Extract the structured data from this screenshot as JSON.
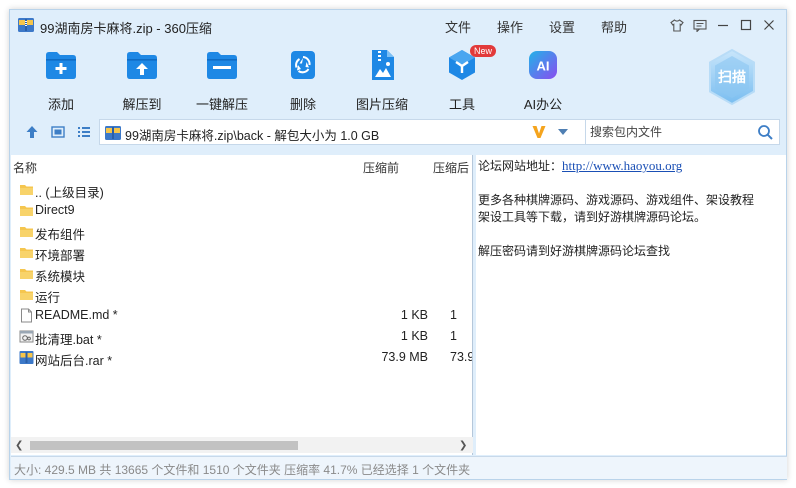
{
  "window": {
    "title": "99湖南房卡麻将.zip - 360压缩"
  },
  "menu": {
    "items": [
      "文件",
      "操作",
      "设置",
      "帮助"
    ]
  },
  "toolbar": {
    "items": [
      {
        "label": "添加",
        "icon": "add-folder-icon"
      },
      {
        "label": "解压到",
        "icon": "extract-to-icon"
      },
      {
        "label": "一键解压",
        "icon": "one-click-extract-icon"
      },
      {
        "label": "删除",
        "icon": "recycle-bin-icon"
      },
      {
        "label": "图片压缩",
        "icon": "image-compress-icon"
      },
      {
        "label": "工具",
        "icon": "tools-icon",
        "badge": "New"
      },
      {
        "label": "AI办公",
        "icon": "ai-office-icon",
        "icon_text": "AI"
      }
    ],
    "scan_label": "扫描"
  },
  "address": {
    "path": "99湖南房卡麻将.zip\\back - 解包大小为 1.0 GB"
  },
  "search": {
    "placeholder": "搜索包内文件"
  },
  "file_list": {
    "columns": [
      "名称",
      "压缩前",
      "压缩后"
    ],
    "rows": [
      {
        "name": ".. (上级目录)",
        "type": "folder",
        "size": "",
        "packed": ""
      },
      {
        "name": "Direct9",
        "type": "folder",
        "size": "",
        "packed": ""
      },
      {
        "name": "发布组件",
        "type": "folder",
        "size": "",
        "packed": ""
      },
      {
        "name": "环境部署",
        "type": "folder",
        "size": "",
        "packed": ""
      },
      {
        "name": "系统模块",
        "type": "folder",
        "size": "",
        "packed": ""
      },
      {
        "name": "运行",
        "type": "folder",
        "size": "",
        "packed": ""
      },
      {
        "name": "README.md *",
        "type": "document",
        "size": "1 KB",
        "packed": "1"
      },
      {
        "name": "批清理.bat *",
        "type": "batch",
        "size": "1 KB",
        "packed": "1"
      },
      {
        "name": "网站后台.rar *",
        "type": "archive",
        "size": "73.9 MB",
        "packed": "73.9"
      }
    ]
  },
  "comment": {
    "forum_label": "论坛网站地址：",
    "forum_link": "http://www.haoyou.org",
    "line2": "更多各种棋牌源码、游戏源码、游戏组件、架设教程",
    "line3": "架设工具等下载，请到好游棋牌源码论坛。",
    "line4": "解压密码请到好游棋牌源码论坛查找"
  },
  "status": {
    "text": "大小: 429.5 MB 共 13665 个文件和 1510 个文件夹 压缩率 41.7% 已经选择 1 个文件夹"
  },
  "colors": {
    "accent_blue": "#1e88e5",
    "window_bg": "#dfeefb",
    "folder_yellow": "#f5c64f",
    "ai_gradient_start": "#22b3e8",
    "ai_gradient_end": "#8a4df0",
    "badge_red": "#e23a3a",
    "link_blue": "#1a4fb5"
  }
}
